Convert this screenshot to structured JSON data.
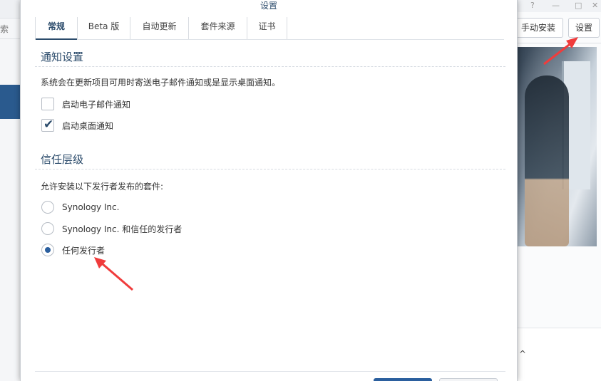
{
  "background_app": {
    "search_fragment": "索",
    "window_controls": [
      "?",
      "—",
      "□",
      "✕"
    ],
    "buttons": {
      "manual_install": "手动安装",
      "settings": "设置"
    },
    "card_glyph": "^"
  },
  "dialog": {
    "title": "设置",
    "tabs": [
      {
        "label": "常规",
        "active": true
      },
      {
        "label": "Beta 版",
        "active": false
      },
      {
        "label": "自动更新",
        "active": false
      },
      {
        "label": "套件来源",
        "active": false
      },
      {
        "label": "证书",
        "active": false
      }
    ],
    "notifications": {
      "title": "通知设置",
      "description": "系统会在更新项目可用时寄送电子邮件通知或是显示桌面通知。",
      "options": [
        {
          "label": "启动电子邮件通知",
          "checked": false
        },
        {
          "label": "启动桌面通知",
          "checked": true
        }
      ]
    },
    "trust_level": {
      "title": "信任层级",
      "description": "允许安装以下发行者发布的套件:",
      "options": [
        {
          "label": "Synology Inc.",
          "selected": false
        },
        {
          "label": "Synology Inc. 和信任的发行者",
          "selected": false
        },
        {
          "label": "任何发行者",
          "selected": true
        }
      ]
    }
  },
  "colors": {
    "accent": "#2b4b6b",
    "radio_fill": "#2b5f9e",
    "annotation_arrow": "#f03c3c",
    "footer_primary": "#2b5f9e"
  },
  "icons": {
    "check": "check-icon",
    "arrow": "red-arrow-annotation"
  }
}
